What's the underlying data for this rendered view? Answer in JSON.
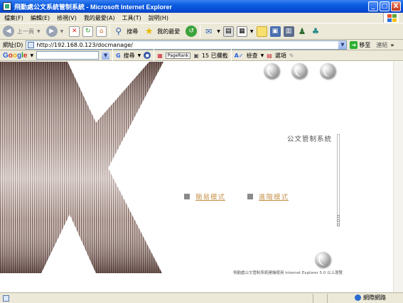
{
  "window": {
    "title": "飛勤處公文系統管制系統 - Microsoft Internet Explorer",
    "buttons": [
      "_",
      "□",
      "X"
    ]
  },
  "menu": {
    "items": [
      "檔案(F)",
      "編輯(E)",
      "檢視(V)",
      "我的最愛(A)",
      "工具(T)",
      "說明(H)"
    ]
  },
  "toolbar": {
    "back_label": "上一頁",
    "search_label": "搜尋",
    "favorites_label": "我的最愛"
  },
  "address": {
    "label": "網址(D)",
    "url": "http://192.168.0.123/docmanage/",
    "go_label": "移至",
    "links_label": "連結"
  },
  "googlebar": {
    "logo": "Google",
    "search_label": "搜尋",
    "pagerank_label": "PageRank",
    "blocked_label": "15 已攔截",
    "check_label": "檢查",
    "options_label": "選項"
  },
  "content": {
    "system_title": "公文管制系統",
    "simple_mode": "簡易模式",
    "advanced_mode": "進階模式",
    "footer_note": "飛勤處公文管制系統建議使用 Internet Explorer 5.0 以上瀏覽"
  },
  "status": {
    "zone": "網際網路"
  },
  "colors": {
    "titlebar": "#0a5ce0",
    "chrome": "#ece9d8",
    "link": "#c89550",
    "square": "#8a8a8a"
  }
}
